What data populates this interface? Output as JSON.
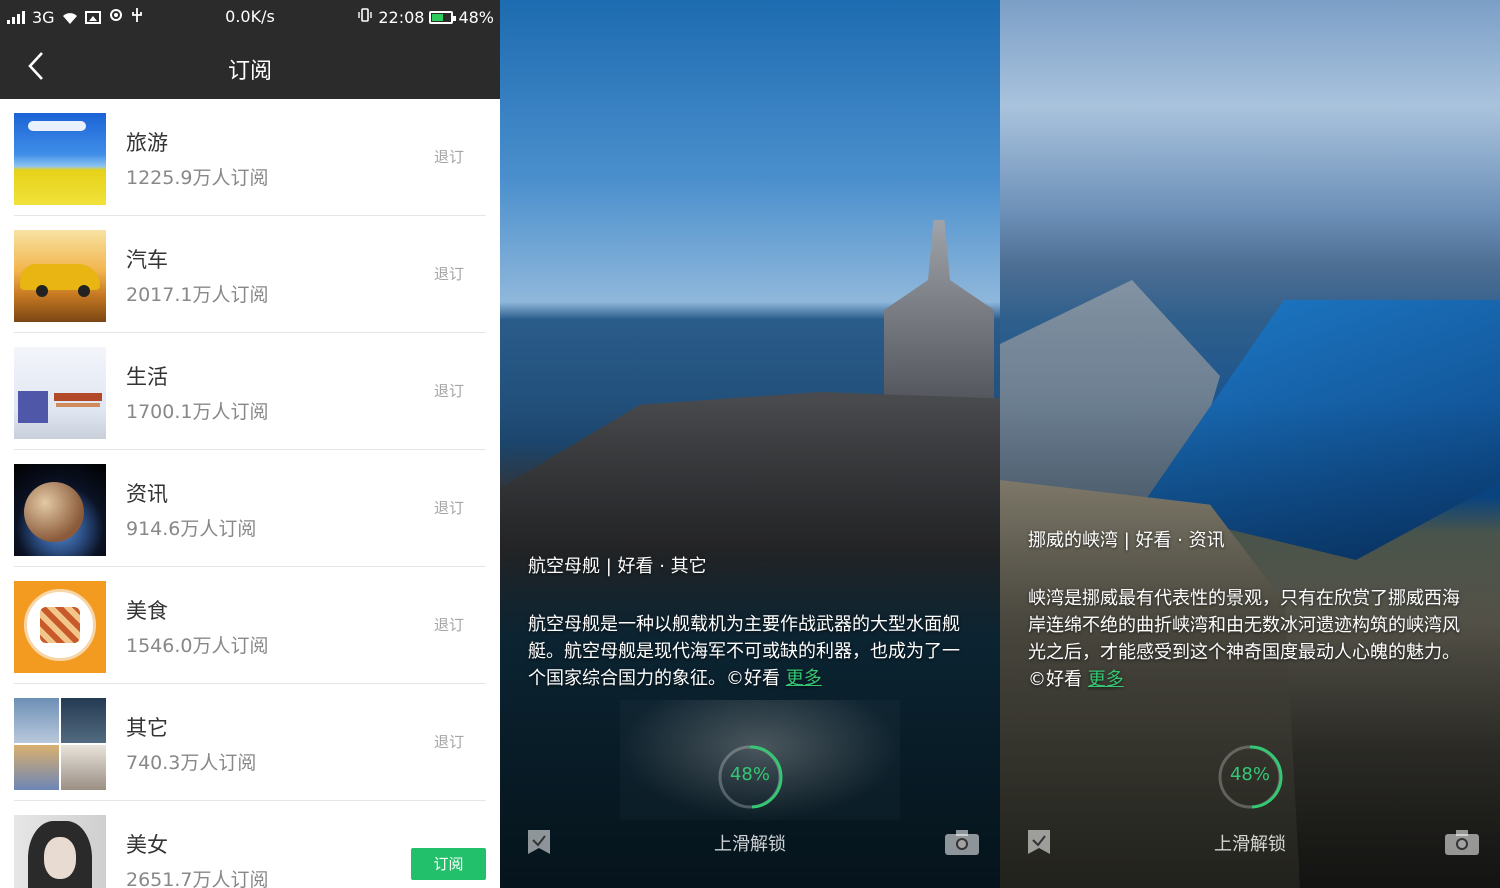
{
  "status_bar": {
    "network": "3G",
    "speed": "0.0K/s",
    "time": "22:08",
    "battery": "48%"
  },
  "header": {
    "title": "订阅"
  },
  "subscriptions": [
    {
      "name": "旅游",
      "count": "1225.9万人订阅",
      "action": "退订"
    },
    {
      "name": "汽车",
      "count": "2017.1万人订阅",
      "action": "退订"
    },
    {
      "name": "生活",
      "count": "1700.1万人订阅",
      "action": "退订"
    },
    {
      "name": "资讯",
      "count": "914.6万人订阅",
      "action": "退订"
    },
    {
      "name": "美食",
      "count": "1546.0万人订阅",
      "action": "退订"
    },
    {
      "name": "其它",
      "count": "740.3万人订阅",
      "action": "退订"
    },
    {
      "name": "美女",
      "count": "2651.7万人订阅",
      "action": "订阅"
    }
  ],
  "lockscreens": [
    {
      "caption": "航空母舰 | 好看 · 其它",
      "description": "航空母舰是一种以舰载机为主要作战武器的大型水面舰艇。航空母舰是现代海军不可或缺的利器，也成为了一个国家综合国力的象征。©好看",
      "more": "更多",
      "progress": "48%",
      "unlock_text": "上滑解锁"
    },
    {
      "caption": "挪威的峡湾 | 好看 · 资讯",
      "description": "峡湾是挪威最有代表性的景观，只有在欣赏了挪威西海岸连绵不绝的曲折峡湾和由无数冰河遗迹构筑的峡湾风光之后，才能感受到这个神奇国度最动人心魄的魅力。©好看",
      "more": "更多",
      "progress": "48%",
      "unlock_text": "上滑解锁"
    }
  ],
  "colors": {
    "accent": "#22c06a",
    "header_bg": "#2b2b2b",
    "progress_ring": "#35c773"
  }
}
